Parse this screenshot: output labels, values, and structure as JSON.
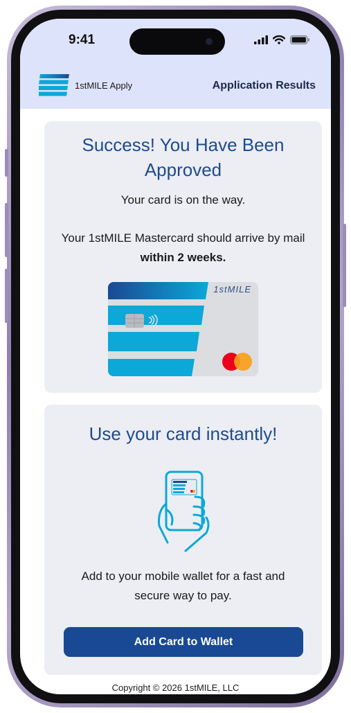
{
  "status_bar": {
    "time": "9:41",
    "icons": [
      "cellular-signal-icon",
      "wifi-icon",
      "battery-icon"
    ]
  },
  "header": {
    "brand_name": "1stMILE Apply",
    "page_title": "Application Results"
  },
  "approval": {
    "title": "Success! You Have Been Approved",
    "subtitle": "Your card is on the way.",
    "arrival_text": "Your 1stMILE Mastercard should arrive by mail",
    "arrival_emphasis": "within 2 weeks.",
    "card_brand": "1stMILE"
  },
  "wallet": {
    "title": "Use your card instantly!",
    "description": "Add to your mobile wallet for a fast and secure way to pay.",
    "button_label": "Add Card to Wallet"
  },
  "footer": {
    "copyright": "Copyright © 2026 1stMILE, LLC"
  },
  "colors": {
    "header_bg": "#dde3fb",
    "heading": "#1d4b8f",
    "button": "#1a4994",
    "card_blue": "#0ba8d8",
    "panel_bg": "#eceef4"
  }
}
